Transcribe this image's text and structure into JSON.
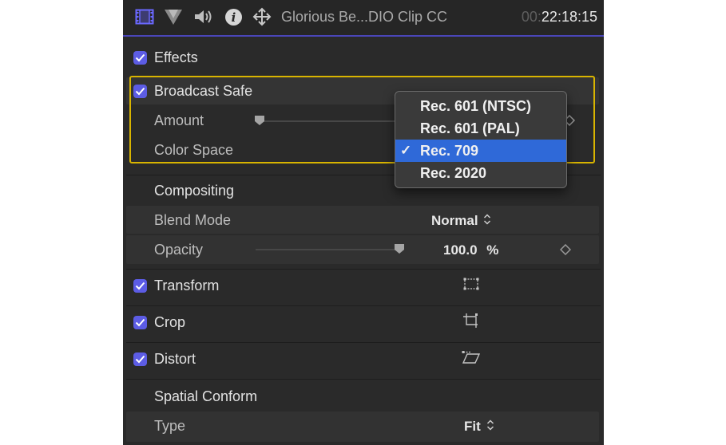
{
  "titlebar": {
    "icons": [
      "film-strip-icon",
      "color-wedge-icon",
      "speaker-icon",
      "info-icon",
      "move-arrows-icon"
    ],
    "clip_name": "Glorious Be...DIO Clip CC",
    "timecode_dim": "00:",
    "timecode": "22:18:15"
  },
  "colors": {
    "accent": "#5c5ce4",
    "highlight": "#d8b400",
    "menu_selected": "#2f69d8",
    "panel_bg": "#2a2a2a"
  },
  "effects": {
    "label": "Effects",
    "checked": true
  },
  "broadcast_safe": {
    "label": "Broadcast Safe",
    "checked": true,
    "amount_label": "Amount",
    "color_space_label": "Color Space"
  },
  "color_space_menu": {
    "items": [
      "Rec. 601 (NTSC)",
      "Rec. 601 (PAL)",
      "Rec. 709",
      "Rec. 2020"
    ],
    "selected": "Rec. 709",
    "check_mark": "✓"
  },
  "compositing": {
    "label": "Compositing",
    "blend_mode_label": "Blend Mode",
    "blend_mode_value": "Normal",
    "opacity_label": "Opacity",
    "opacity_value": "100.0",
    "opacity_unit": "%",
    "opacity_level": 1.0
  },
  "transform": {
    "label": "Transform",
    "checked": true
  },
  "crop": {
    "label": "Crop",
    "checked": true
  },
  "distort": {
    "label": "Distort",
    "checked": true
  },
  "spatial_conform": {
    "label": "Spatial Conform",
    "type_label": "Type",
    "type_value": "Fit"
  }
}
